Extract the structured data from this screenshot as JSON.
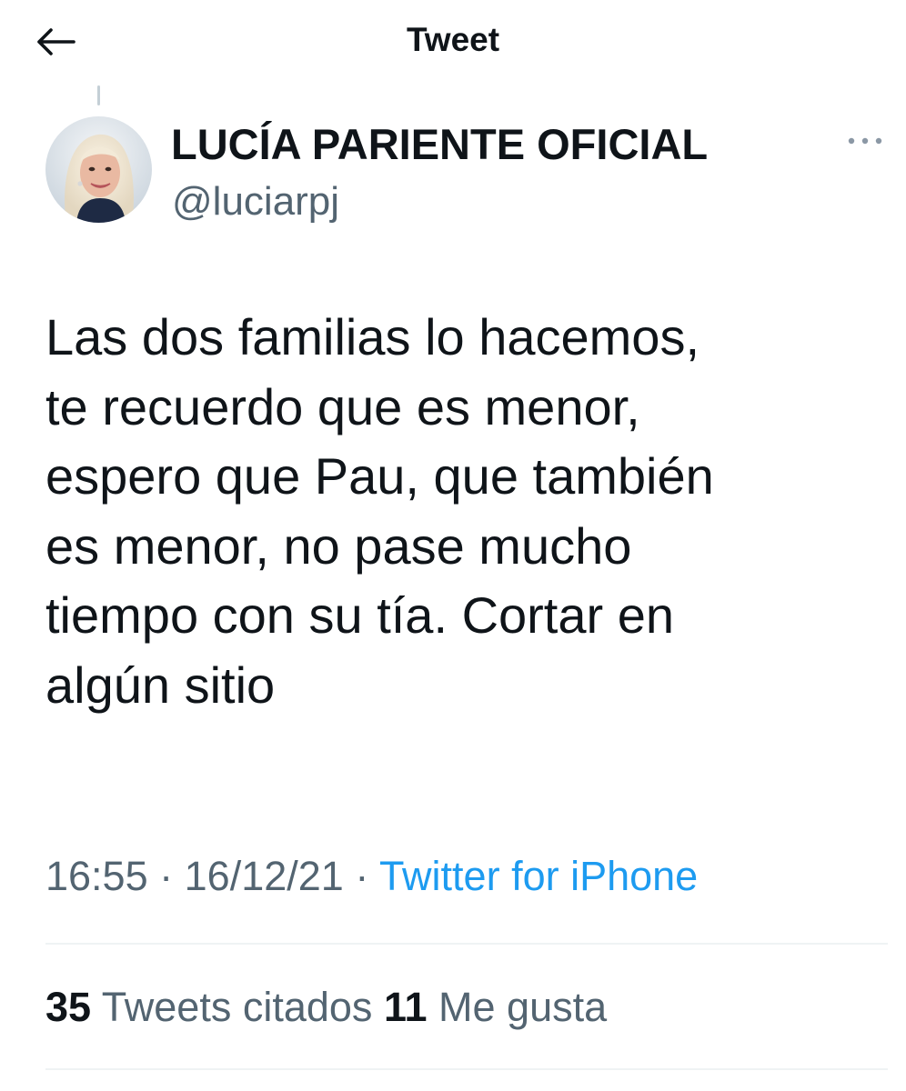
{
  "header": {
    "title": "Tweet",
    "back_icon": "arrow-left-icon"
  },
  "author": {
    "name": "LUCÍA PARIENTE OFICIAL",
    "handle": "@luciarpj",
    "more_icon": "more-horizontal-icon"
  },
  "tweet": {
    "lines": [
      "Las dos familias lo hacemos,",
      "te recuerdo que es menor,",
      "espero que Pau, que también",
      "es menor, no pase mucho",
      "tiempo con su tía. Cortar en",
      "algún sitio"
    ],
    "time": "16:55",
    "date": "16/12/21",
    "separator": "·",
    "source": "Twitter for iPhone"
  },
  "stats": {
    "quote_count": "35",
    "quote_label": "Tweets citados",
    "like_count": "11",
    "like_label": "Me gusta"
  },
  "colors": {
    "text": "#0f1419",
    "secondary": "#536471",
    "link": "#1d9bf0",
    "divider": "#eff3f4"
  }
}
